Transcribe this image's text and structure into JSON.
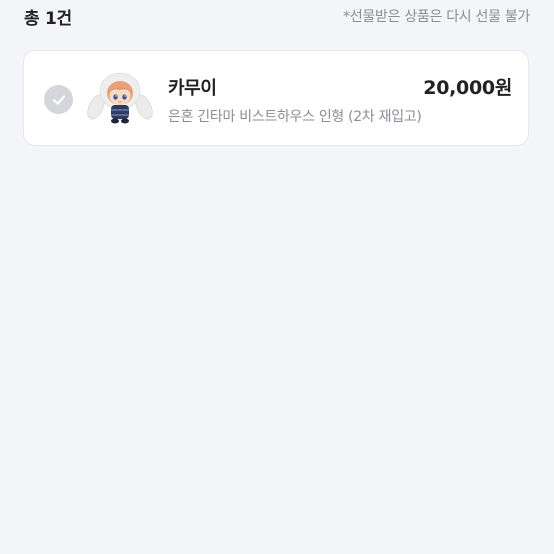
{
  "header": {
    "total_label": "총 1건",
    "notice": "*선물받은 상품은 다시 선물 불가"
  },
  "items": [
    {
      "name": "카무이",
      "description": "은혼 긴타마 비스트하우스 인형 (2차 재입고)",
      "price": "20,000원",
      "selected": true,
      "thumbnail_icon": "plush-doll-image"
    }
  ],
  "colors": {
    "background": "#f4f5f9",
    "card": "#ffffff",
    "check_circle": "#d4d6dc",
    "muted_text": "#8a8d96"
  }
}
